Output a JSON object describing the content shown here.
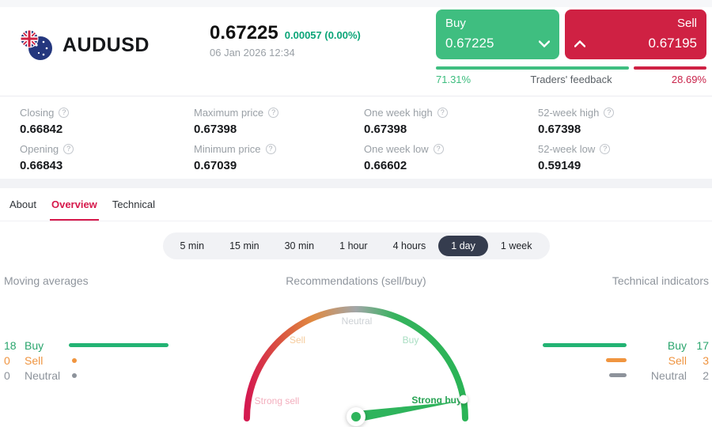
{
  "header": {
    "pair": "AUDUSD",
    "price": "0.67225",
    "change": "0.00057 (0.00%)",
    "datetime": "06 Jan 2026 12:34",
    "buy": {
      "label": "Buy",
      "price": "0.67225"
    },
    "sell": {
      "label": "Sell",
      "price": "0.67195"
    },
    "feedback": {
      "buy_pct": "71.31%",
      "label": "Traders' feedback",
      "sell_pct": "28.69%"
    }
  },
  "stats": {
    "help_icon": "?",
    "items": [
      {
        "label": "Closing",
        "value": "0.66842"
      },
      {
        "label": "Maximum price",
        "value": "0.67398"
      },
      {
        "label": "One week high",
        "value": "0.67398"
      },
      {
        "label": "52-week high",
        "value": "0.67398"
      },
      {
        "label": "Opening",
        "value": "0.66843"
      },
      {
        "label": "Minimum price",
        "value": "0.67039"
      },
      {
        "label": "One week low",
        "value": "0.66602"
      },
      {
        "label": "52-week low",
        "value": "0.59149"
      }
    ]
  },
  "tabs": {
    "items": [
      {
        "label": "About"
      },
      {
        "label": "Overview",
        "active": true
      },
      {
        "label": "Technical"
      }
    ]
  },
  "periods": {
    "items": [
      "5 min",
      "15 min",
      "30 min",
      "1 hour",
      "4 hours",
      "1 day",
      "1 week"
    ],
    "active": "1 day"
  },
  "sections": {
    "moving_averages": "Moving averages",
    "recommendations": "Recommendations (sell/buy)",
    "technical_indicators": "Technical indicators"
  },
  "moving_averages": {
    "rows": [
      {
        "count": "18",
        "label": "Buy"
      },
      {
        "count": "0",
        "label": "Sell"
      },
      {
        "count": "0",
        "label": "Neutral"
      }
    ]
  },
  "technical_indicators": {
    "rows": [
      {
        "label": "Buy",
        "count": "17"
      },
      {
        "label": "Sell",
        "count": "3"
      },
      {
        "label": "Neutral",
        "count": "2"
      }
    ]
  },
  "gauge": {
    "labels": {
      "strong_sell": "Strong sell",
      "sell": "Sell",
      "neutral": "Neutral",
      "buy": "Buy",
      "strong_buy": "Strong buy"
    },
    "needle_points_to": "Strong buy"
  },
  "colors": {
    "buy_green": "#3fbe80",
    "sell_red": "#cf2143",
    "orange": "#f0953f",
    "neutral_gray": "#8d939b",
    "active_tab": "#d6194b",
    "active_period_bg": "#353c4e"
  }
}
